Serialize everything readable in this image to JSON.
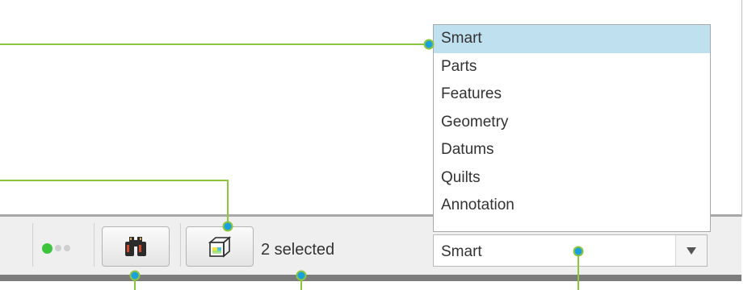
{
  "status_bar": {
    "selected_count": "2 selected",
    "find_button_icon": "binoculars-icon",
    "selection_button_icon": "box-selection-icon",
    "message_lights": [
      "green-light",
      "gray-light",
      "gray-light"
    ]
  },
  "filter": {
    "value": "Smart",
    "options": [
      "Smart",
      "Parts",
      "Features",
      "Geometry",
      "Datums",
      "Quilts",
      "Annotation"
    ],
    "highlighted": "Smart"
  },
  "colors": {
    "callout_line": "#8cc63f",
    "callout_dot": "#1aa0dc",
    "highlight": "#bfe0ef",
    "status_ok": "#3cc43c"
  }
}
